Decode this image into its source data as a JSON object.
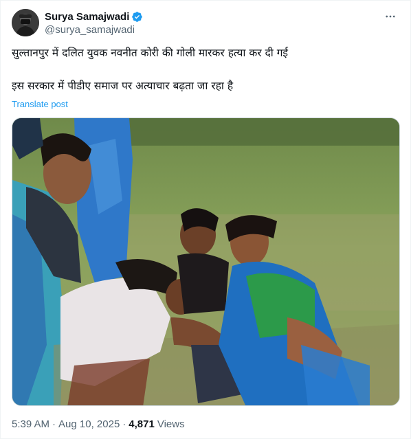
{
  "author": {
    "display_name": "Surya Samajwadi",
    "handle": "@surya_samajwadi",
    "verified": true,
    "avatar_icon": "masked-person-avatar-icon"
  },
  "tweet": {
    "line1": "सुल्तानपुर में दलित युवक नवनीत कोरी की गोली मारकर हत्या कर दी गई",
    "line2": "इस सरकार में पीडीए समाज पर अत्याचार बढ़ता जा रहा है",
    "translate_label": "Translate post",
    "media_icon": "photo-of-grieving-women-in-field"
  },
  "meta": {
    "time": "5:39 AM",
    "date": "Aug 10, 2025",
    "separator_1": "·",
    "separator_2": "·",
    "views_count": "4,871",
    "views_label": "Views"
  },
  "colors": {
    "accent": "#1d9bf0",
    "text_primary": "#0f1419",
    "text_secondary": "#536471",
    "border": "#cfd9de"
  }
}
